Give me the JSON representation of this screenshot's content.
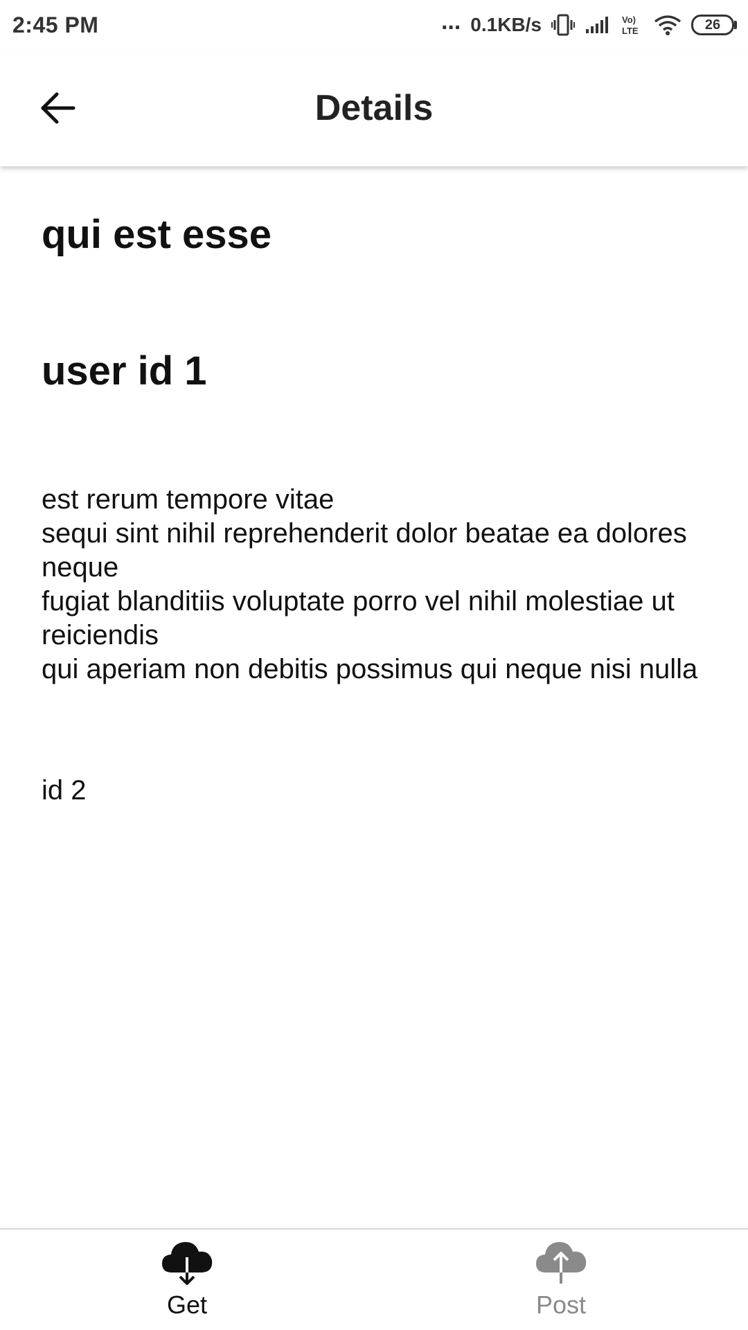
{
  "status_bar": {
    "time": "2:45 PM",
    "dots": "...",
    "network_speed": "0.1KB/s",
    "volte_label": "Vo) LTE",
    "battery_level": "26"
  },
  "app_bar": {
    "title": "Details"
  },
  "post": {
    "title": "qui est esse",
    "user": "user id 1",
    "body_lines": [
      "est rerum tempore vitae",
      "sequi sint nihil reprehenderit dolor beatae ea dolores neque",
      "fugiat blanditiis voluptate porro vel nihil molestiae ut reiciendis",
      "qui aperiam non debitis possimus qui neque nisi nulla"
    ],
    "id_label": "id 2"
  },
  "bottom_nav": {
    "items": [
      {
        "label": "Get",
        "icon": "cloud-download-icon",
        "active": true
      },
      {
        "label": "Post",
        "icon": "cloud-upload-icon",
        "active": false
      }
    ]
  },
  "colors": {
    "active": "#111111",
    "inactive": "#8a8a8a",
    "divider": "#d8d8d8"
  }
}
